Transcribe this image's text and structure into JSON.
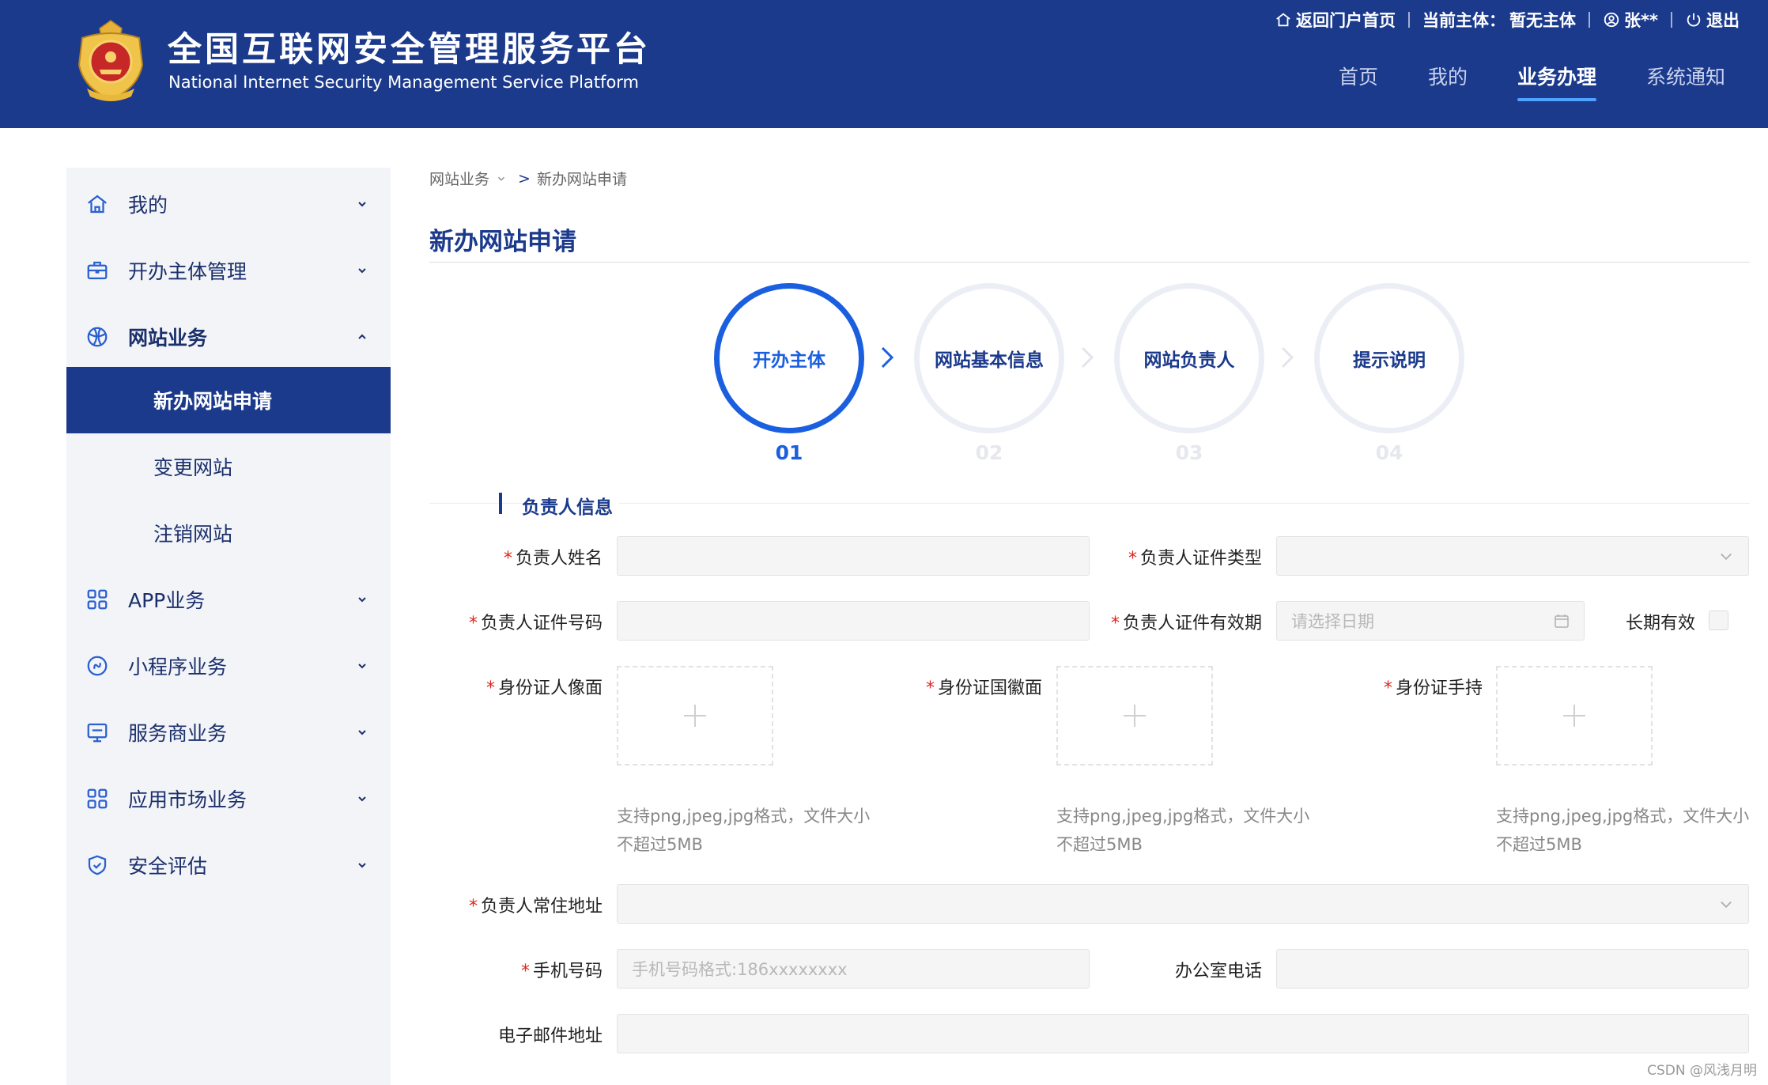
{
  "colors": {
    "header_bg": "#1b3a8c",
    "accent": "#1a5fe0",
    "required": "#e2231a",
    "sidebar_bg": "#f2f4f8"
  },
  "header": {
    "title": "全国互联网安全管理服务平台",
    "subtitle": "National Internet Security Management Service Platform",
    "topbar": {
      "home_portal": "返回门户首页",
      "current_subject_label": "当前主体：",
      "current_subject_value": "暂无主体",
      "user": "张**",
      "logout": "退出"
    },
    "nav": [
      {
        "label": "首页",
        "active": false
      },
      {
        "label": "我的",
        "active": false
      },
      {
        "label": "业务办理",
        "active": true
      },
      {
        "label": "系统通知",
        "active": false
      }
    ]
  },
  "sidebar": {
    "items": [
      {
        "label": "我的",
        "icon": "home-icon",
        "expanded": false
      },
      {
        "label": "开办主体管理",
        "icon": "briefcase-icon",
        "expanded": false
      },
      {
        "label": "网站业务",
        "icon": "globe-icon",
        "expanded": true,
        "children": [
          {
            "label": "新办网站申请",
            "active": true
          },
          {
            "label": "变更网站",
            "active": false
          },
          {
            "label": "注销网站",
            "active": false
          }
        ]
      },
      {
        "label": "APP业务",
        "icon": "grid-icon",
        "expanded": false
      },
      {
        "label": "小程序业务",
        "icon": "mini-program-icon",
        "expanded": false
      },
      {
        "label": "服务商业务",
        "icon": "monitor-icon",
        "expanded": false
      },
      {
        "label": "应用市场业务",
        "icon": "grid-icon",
        "expanded": false
      },
      {
        "label": "安全评估",
        "icon": "shield-icon",
        "expanded": false
      }
    ]
  },
  "breadcrumb": {
    "parent": "网站业务",
    "separator": ">",
    "current": "新办网站申请"
  },
  "page_title": "新办网站申请",
  "steps": [
    {
      "label": "开办主体",
      "num": "01",
      "active": true
    },
    {
      "label": "网站基本信息",
      "num": "02",
      "active": false
    },
    {
      "label": "网站负责人",
      "num": "03",
      "active": false
    },
    {
      "label": "提示说明",
      "num": "04",
      "active": false
    }
  ],
  "form": {
    "section_title": "负责人信息",
    "required_mark": "*",
    "name_label": "负责人姓名",
    "name_value": "",
    "id_type_label": "负责人证件类型",
    "id_type_value": "",
    "id_number_label": "负责人证件号码",
    "id_number_value": "",
    "id_validity_label": "负责人证件有效期",
    "id_validity_placeholder": "请选择日期",
    "long_term_label": "长期有效",
    "long_term_checked": false,
    "id_front_label": "身份证人像面",
    "id_back_label": "身份证国徽面",
    "id_handheld_label": "身份证手持",
    "upload_hint": "支持png,jpeg,jpg格式，文件大小不超过5MB",
    "address_label": "负责人常住地址",
    "address_value": "",
    "phone_label": "手机号码",
    "phone_placeholder": "手机号码格式:186xxxxxxxx",
    "office_phone_label": "办公室电话",
    "office_phone_value": "",
    "email_label": "电子邮件地址",
    "email_value": ""
  },
  "watermark": "CSDN @风浅月明"
}
